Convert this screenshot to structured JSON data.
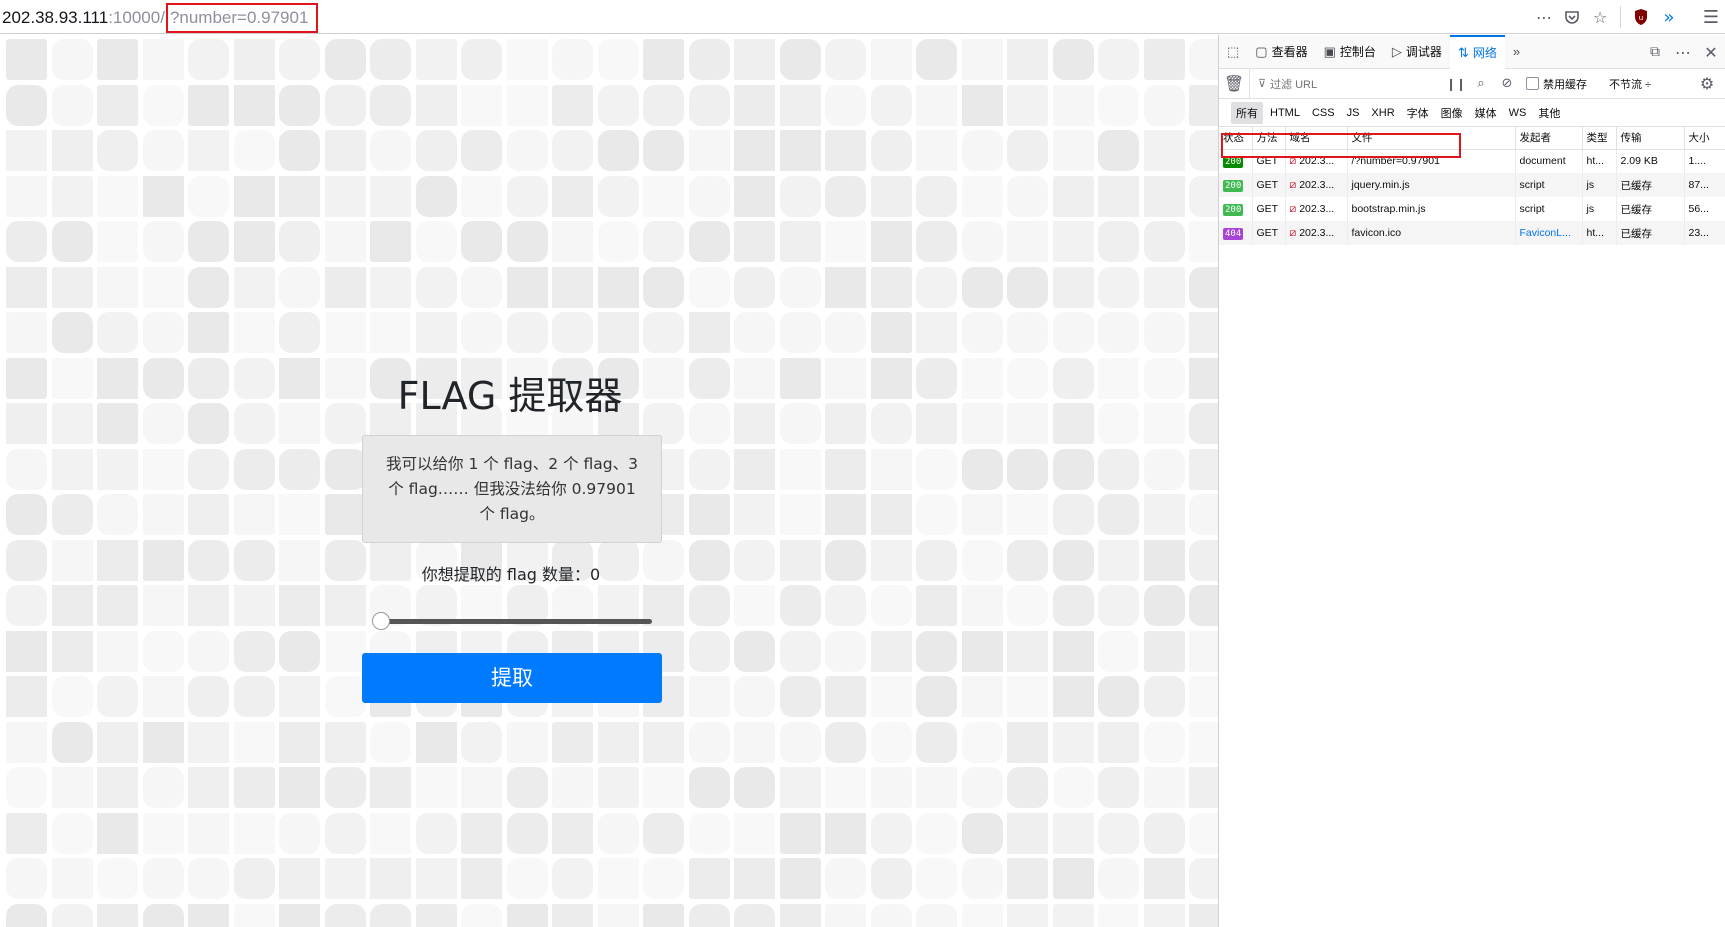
{
  "browser": {
    "url_host": "202.38.93.111",
    "url_port": ":10000/",
    "url_query": "?number=0.97901",
    "icons": [
      "more-icon",
      "pocket-icon",
      "bookmark-star-icon",
      "ublock-icon",
      "extensions-overflow-icon",
      "menu-icon"
    ]
  },
  "page": {
    "title": "FLAG 提取器",
    "message": "我可以给你 1 个 flag、2 个 flag、3 个 flag…… 但我没法给你 0.97901 个 flag。",
    "quantity_label": "你想提取的 flag 数量：0",
    "slider_value": 0,
    "submit_label": "提取",
    "colors": {
      "button": "#007bff",
      "tile_light": "#f4f4f4",
      "tile_dark": "#e6e6e6"
    }
  },
  "devtools": {
    "tabs": [
      {
        "label": "查看器",
        "icon": "inspector-icon"
      },
      {
        "label": "控制台",
        "icon": "console-icon"
      },
      {
        "label": "调试器",
        "icon": "debugger-icon"
      },
      {
        "label": "网络",
        "icon": "network-icon",
        "active": true
      }
    ],
    "filter_placeholder": "过滤 URL",
    "disable_cache_label": "禁用缓存",
    "throttle_label": "不节流 ÷",
    "types": [
      "所有",
      "HTML",
      "CSS",
      "JS",
      "XHR",
      "字体",
      "图像",
      "媒体",
      "WS",
      "其他"
    ],
    "columns": [
      "状态",
      "方法",
      "域名",
      "文件",
      "发起者",
      "类型",
      "传输",
      "大小"
    ],
    "rows": [
      {
        "status": "200",
        "method": "GET",
        "domain": "202.3...",
        "file": "/?number=0.97901",
        "initiator": "document",
        "type": "ht...",
        "transfer": "2.09 KB",
        "size": "1....",
        "status_color": "#058b00"
      },
      {
        "status": "200",
        "method": "GET",
        "domain": "202.3...",
        "file": "jquery.min.js",
        "initiator": "script",
        "type": "js",
        "transfer": "已缓存",
        "size": "87...",
        "status_color": "#3fb950"
      },
      {
        "status": "200",
        "method": "GET",
        "domain": "202.3...",
        "file": "bootstrap.min.js",
        "initiator": "script",
        "type": "js",
        "transfer": "已缓存",
        "size": "56...",
        "status_color": "#3fb950"
      },
      {
        "status": "404",
        "method": "GET",
        "domain": "202.3...",
        "file": "favicon.ico",
        "initiator": "FaviconL...",
        "type": "ht...",
        "transfer": "已缓存",
        "size": "23...",
        "status_color": "#a845d6"
      }
    ]
  }
}
